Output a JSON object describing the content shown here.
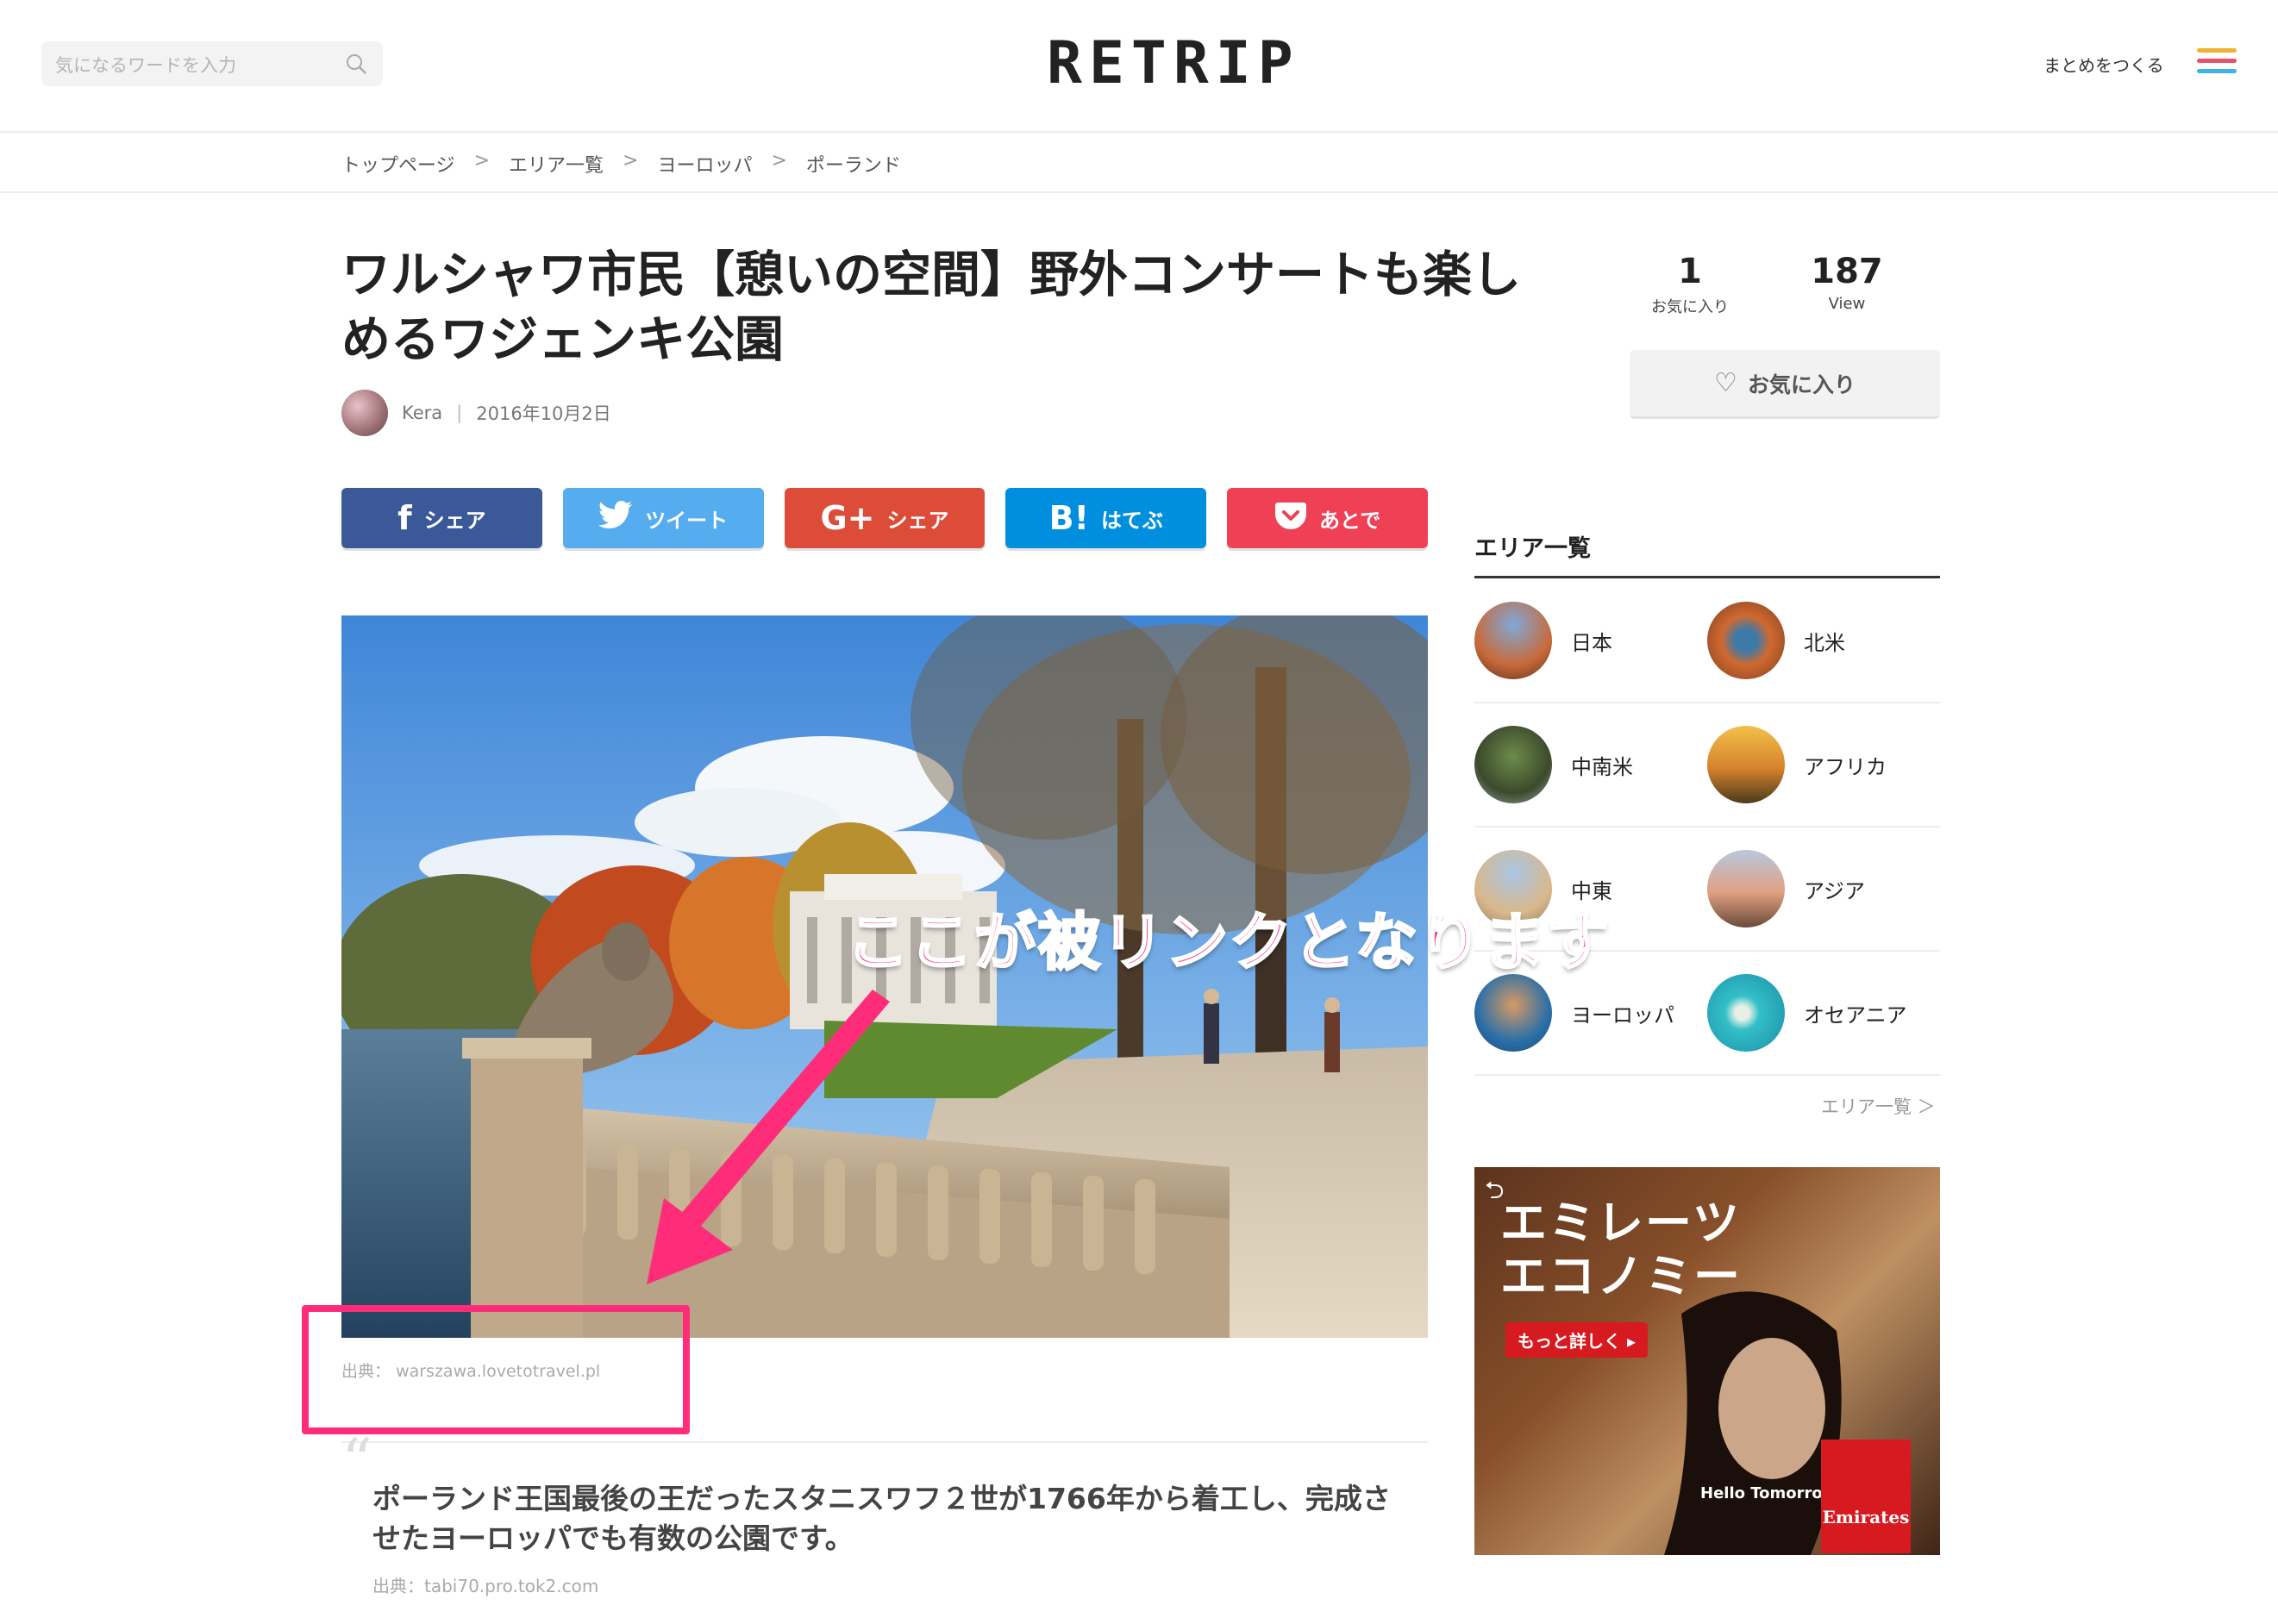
{
  "header": {
    "search_placeholder": "気になるワードを入力",
    "logo": "RETRIP",
    "make_summary": "まとめをつくる",
    "menu_colors": [
      "#f0b22e",
      "#e9506b",
      "#3cb4e6"
    ]
  },
  "breadcrumb": {
    "items": [
      "トップページ",
      "エリア一覧",
      "ヨーロッパ",
      "ポーランド"
    ],
    "separator": ">"
  },
  "article": {
    "title": "ワルシャワ市民【憩いの空間】野外コンサートも楽しめるワジェンキ公園",
    "author": "Kera",
    "date": "2016年10月2日",
    "share_buttons": [
      {
        "icon": "f",
        "label": "シェア",
        "color": "#3b5998"
      },
      {
        "icon": "🐦",
        "label": "ツイート",
        "color": "#55acee"
      },
      {
        "icon": "G+",
        "label": "シェア",
        "color": "#dd4b39"
      },
      {
        "icon": "B!",
        "label": "はてぶ",
        "color": "#008fde"
      },
      {
        "icon": "♥",
        "label": "あとで",
        "color": "#ef4056"
      }
    ],
    "image_source_label": "出典：",
    "image_source": "warszawa.lovetotravel.pl",
    "quote_text": "ポーランド王国最後の王だったスタニスワフ２世が1766年から着工し、完成させたヨーロッパでも有数の公園です。",
    "quote_source": "出典：tabi70.pro.tok2.com"
  },
  "stats": {
    "favorites_count": "1",
    "favorites_label": "お気に入り",
    "views_count": "187",
    "views_label": "View",
    "fav_button_label": "お気に入り"
  },
  "areas": {
    "heading": "エリア一覧",
    "rows": [
      [
        {
          "label": "日本"
        },
        {
          "label": "北米"
        }
      ],
      [
        {
          "label": "中南米"
        },
        {
          "label": "アフリカ"
        }
      ],
      [
        {
          "label": "中東"
        },
        {
          "label": "アジア"
        }
      ],
      [
        {
          "label": "ヨーロッパ"
        },
        {
          "label": "オセアニア"
        }
      ]
    ],
    "more_link": "エリア一覧 ＞"
  },
  "ad": {
    "title_line1": "エミレーツ",
    "title_line2": "エコノミー",
    "cta": "もっと詳しく ▸",
    "tagline": "Hello Tomorrow",
    "brand": "Emirates"
  },
  "annotation": {
    "text": "ここが被リンクとなります",
    "color": "#ff2d79"
  }
}
